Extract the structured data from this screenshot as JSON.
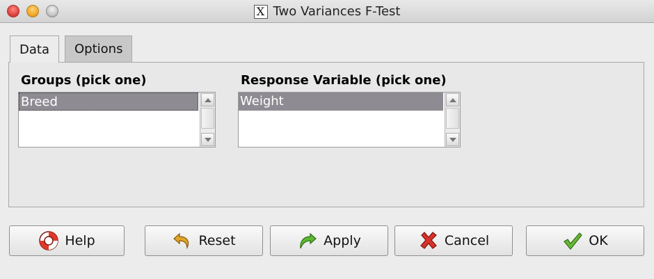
{
  "window": {
    "title": "Two Variances F-Test",
    "app_icon": "X"
  },
  "tabs": [
    {
      "label": "Data",
      "active": true
    },
    {
      "label": "Options",
      "active": false
    }
  ],
  "groups": {
    "label": "Groups (pick one)",
    "items": [
      "Breed"
    ],
    "selected": "Breed"
  },
  "response": {
    "label": "Response Variable (pick one)",
    "items": [
      "Weight"
    ],
    "selected": "Weight"
  },
  "buttons": {
    "help": {
      "label": "Help",
      "icon": "lifebuoy-icon"
    },
    "reset": {
      "label": "Reset",
      "icon": "undo-arrow-icon"
    },
    "apply": {
      "label": "Apply",
      "icon": "green-redo-arrow-icon"
    },
    "cancel": {
      "label": "Cancel",
      "icon": "red-x-icon"
    },
    "ok": {
      "label": "OK",
      "icon": "green-check-icon"
    }
  },
  "colors": {
    "selection_bg": "#8f8b93",
    "window_bg": "#ececec"
  }
}
